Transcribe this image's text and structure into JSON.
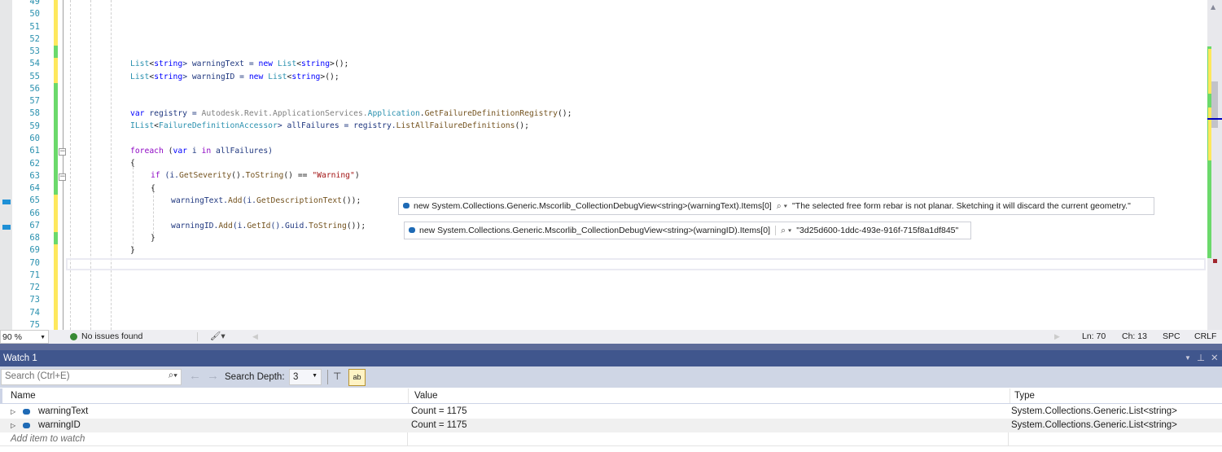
{
  "editor": {
    "line_numbers": [
      "49",
      "50",
      "51",
      "52",
      "53",
      "54",
      "55",
      "56",
      "57",
      "58",
      "59",
      "60",
      "61",
      "62",
      "63",
      "64",
      "65",
      "66",
      "67",
      "68",
      "69",
      "70",
      "71",
      "72",
      "73",
      "74",
      "75"
    ],
    "code": {
      "l54": [
        "List",
        "<",
        "string",
        "> warningText = ",
        "new",
        " ",
        "List",
        "<",
        "string",
        ">();"
      ],
      "l55": [
        "List",
        "<",
        "string",
        "> warningID = ",
        "new",
        " ",
        "List",
        "<",
        "string",
        ">();"
      ],
      "l58": [
        "var",
        " registry = ",
        "Autodesk.Revit.ApplicationServices.",
        "Application",
        ".",
        "GetFailureDefinitionRegistry",
        "();"
      ],
      "l59": [
        "IList",
        "<",
        "FailureDefinitionAccessor",
        "> allFailures = registry.",
        "ListAllFailureDefinitions",
        "();"
      ],
      "l61": [
        "foreach",
        " (",
        "var",
        " i ",
        "in",
        " allFailures)"
      ],
      "l62": "{",
      "l63": [
        "if",
        " (i.",
        "GetSeverity",
        "().",
        "ToString",
        "() == ",
        "\"Warning\"",
        ")"
      ],
      "l64": "{",
      "l65": [
        "warningText.",
        "Add",
        "(i.",
        "GetDescriptionText",
        "());"
      ],
      "l67": [
        "warningID.",
        "Add",
        "(i.",
        "GetId",
        "().Guid.",
        "ToString",
        "());"
      ],
      "l68": "}",
      "l69": "}"
    },
    "datatips": [
      {
        "expression": "new System.Collections.Generic.Mscorlib_CollectionDebugView<string>(warningText).Items[0]",
        "value": "\"The selected free form rebar is not planar. Sketching it will discard the current geometry.\""
      },
      {
        "expression": "new System.Collections.Generic.Mscorlib_CollectionDebugView<string>(warningID).Items[0]",
        "value": "\"3d25d600-1ddc-493e-916f-715f8a1df845\""
      }
    ]
  },
  "status": {
    "zoom": "90 %",
    "issues": "No issues found",
    "line": "Ln: 70",
    "col": "Ch: 13",
    "spacing": "SPC",
    "eol": "CRLF"
  },
  "watch": {
    "title": "Watch 1",
    "search_placeholder": "Search (Ctrl+E)",
    "search_depth_label": "Search Depth:",
    "search_depth_value": "3",
    "columns": [
      "Name",
      "Value",
      "Type"
    ],
    "rows": [
      {
        "name": "warningText",
        "value": "Count = 1175",
        "type": "System.Collections.Generic.List<string>"
      },
      {
        "name": "warningID",
        "value": "Count = 1175",
        "type": "System.Collections.Generic.List<string>"
      }
    ],
    "add_item": "Add item to watch"
  },
  "colors": {
    "accent": "#40568d",
    "line_number": "#2b91af",
    "changed": "#fee85d",
    "saved": "#6bd96b"
  }
}
